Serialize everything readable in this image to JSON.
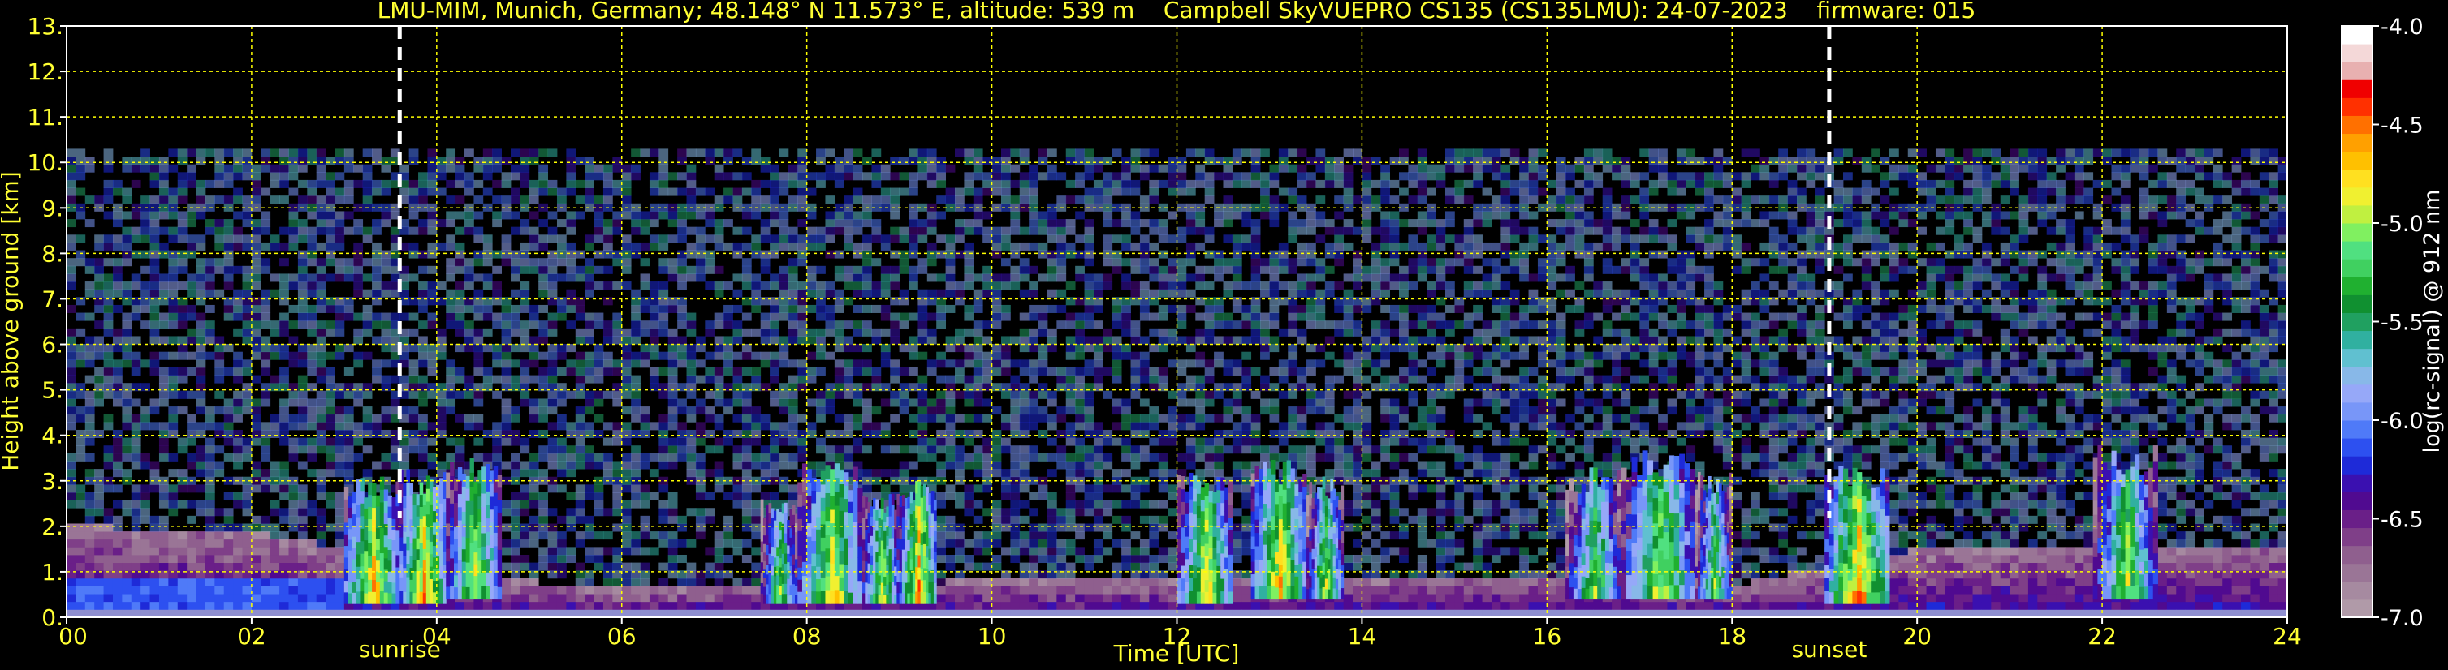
{
  "chart_data": {
    "type": "heatmap",
    "title": "LMU-MIM, Munich, Germany; 48.148° N 11.573° E, altitude: 539 m    Campbell SkyVUEPRO CS135 (CS135LMU): 24-07-2023    firmware: 015",
    "xlabel": "Time [UTC]",
    "ylabel": "Height above ground [km]",
    "xlim": [
      0,
      24
    ],
    "ylim": [
      0,
      13
    ],
    "x_tick_labels": [
      "00",
      "02",
      "04",
      "06",
      "08",
      "10",
      "12",
      "14",
      "16",
      "18",
      "20",
      "22",
      "24"
    ],
    "y_tick_labels": [
      "0.",
      "1.",
      "2.",
      "3.",
      "4.",
      "5.",
      "6.",
      "7.",
      "8.",
      "9.",
      "10.",
      "11.",
      "12.",
      "13."
    ],
    "grid": true,
    "grid_color": "#ffff00",
    "text_color": "#ffff33",
    "colorbar": {
      "label": "log(rc-signal) @ 912 nm",
      "range": [
        -7.0,
        -4.0
      ],
      "tick_labels": [
        "-7.0",
        "-6.5",
        "-6.0",
        "-5.5",
        "-5.0",
        "-4.5",
        "-4.0"
      ],
      "colors": [
        "#b09aa8",
        "#a68aa0",
        "#9a7596",
        "#8f5f8e",
        "#7f3f88",
        "#6a1f88",
        "#500a90",
        "#3a10b0",
        "#1e2ad8",
        "#2d50f0",
        "#4f7af8",
        "#7896f8",
        "#96a8f8",
        "#88b8e8",
        "#60c0d0",
        "#30b0a0",
        "#20a060",
        "#109030",
        "#20b030",
        "#40d060",
        "#50e080",
        "#80f060",
        "#c0f040",
        "#f0f030",
        "#ffe020",
        "#ffc000",
        "#ffa000",
        "#ff7000",
        "#ff3000",
        "#f00000",
        "#e8b0b0",
        "#f4d8d8",
        "#ffffff"
      ]
    },
    "markers": [
      {
        "label": "sunrise",
        "x": 3.6
      },
      {
        "label": "sunset",
        "x": 19.05
      }
    ],
    "background_layer_top_km": 10.3,
    "boundary_layer_tops_km": [
      {
        "x": 0,
        "y": 2.0
      },
      {
        "x": 2,
        "y": 1.9
      },
      {
        "x": 3,
        "y": 1.5
      },
      {
        "x": 4,
        "y": 1.0
      },
      {
        "x": 6,
        "y": 0.6
      },
      {
        "x": 8,
        "y": 0.7
      },
      {
        "x": 10,
        "y": 0.8
      },
      {
        "x": 12,
        "y": 0.8
      },
      {
        "x": 14,
        "y": 0.9
      },
      {
        "x": 16,
        "y": 0.9
      },
      {
        "x": 18,
        "y": 0.7
      },
      {
        "x": 19,
        "y": 1.1
      },
      {
        "x": 20,
        "y": 1.5
      },
      {
        "x": 22,
        "y": 1.6
      },
      {
        "x": 24,
        "y": 1.6
      }
    ],
    "cloud_bands": [
      {
        "x0": 3.0,
        "x1": 3.6,
        "base_km": 0.3,
        "top_km": 3.1,
        "peak": -4.4
      },
      {
        "x0": 3.6,
        "x1": 4.1,
        "base_km": 0.3,
        "top_km": 3.3,
        "peak": -4.3
      },
      {
        "x0": 4.1,
        "x1": 4.7,
        "base_km": 0.4,
        "top_km": 3.5,
        "peak": -4.6
      },
      {
        "x0": 7.5,
        "x1": 7.9,
        "base_km": 0.3,
        "top_km": 2.6,
        "peak": -4.8
      },
      {
        "x0": 7.9,
        "x1": 8.6,
        "base_km": 0.3,
        "top_km": 3.4,
        "peak": -4.5
      },
      {
        "x0": 8.6,
        "x1": 9.0,
        "base_km": 0.3,
        "top_km": 2.8,
        "peak": -4.6
      },
      {
        "x0": 9.0,
        "x1": 9.4,
        "base_km": 0.3,
        "top_km": 3.0,
        "peak": -4.3
      },
      {
        "x0": 12.0,
        "x1": 12.6,
        "base_km": 0.3,
        "top_km": 3.2,
        "peak": -4.5
      },
      {
        "x0": 12.8,
        "x1": 13.4,
        "base_km": 0.4,
        "top_km": 3.5,
        "peak": -4.4
      },
      {
        "x0": 13.4,
        "x1": 13.8,
        "base_km": 0.4,
        "top_km": 3.1,
        "peak": -4.7
      },
      {
        "x0": 16.2,
        "x1": 16.8,
        "base_km": 0.4,
        "top_km": 3.3,
        "peak": -4.8
      },
      {
        "x0": 16.8,
        "x1": 17.6,
        "base_km": 0.4,
        "top_km": 3.7,
        "peak": -4.6
      },
      {
        "x0": 17.6,
        "x1": 18.0,
        "base_km": 0.4,
        "top_km": 3.2,
        "peak": -4.8
      },
      {
        "x0": 19.0,
        "x1": 19.7,
        "base_km": 0.3,
        "top_km": 3.4,
        "peak": -4.3
      },
      {
        "x0": 21.9,
        "x1": 22.6,
        "base_km": 0.4,
        "top_km": 3.8,
        "peak": -4.7
      }
    ]
  }
}
